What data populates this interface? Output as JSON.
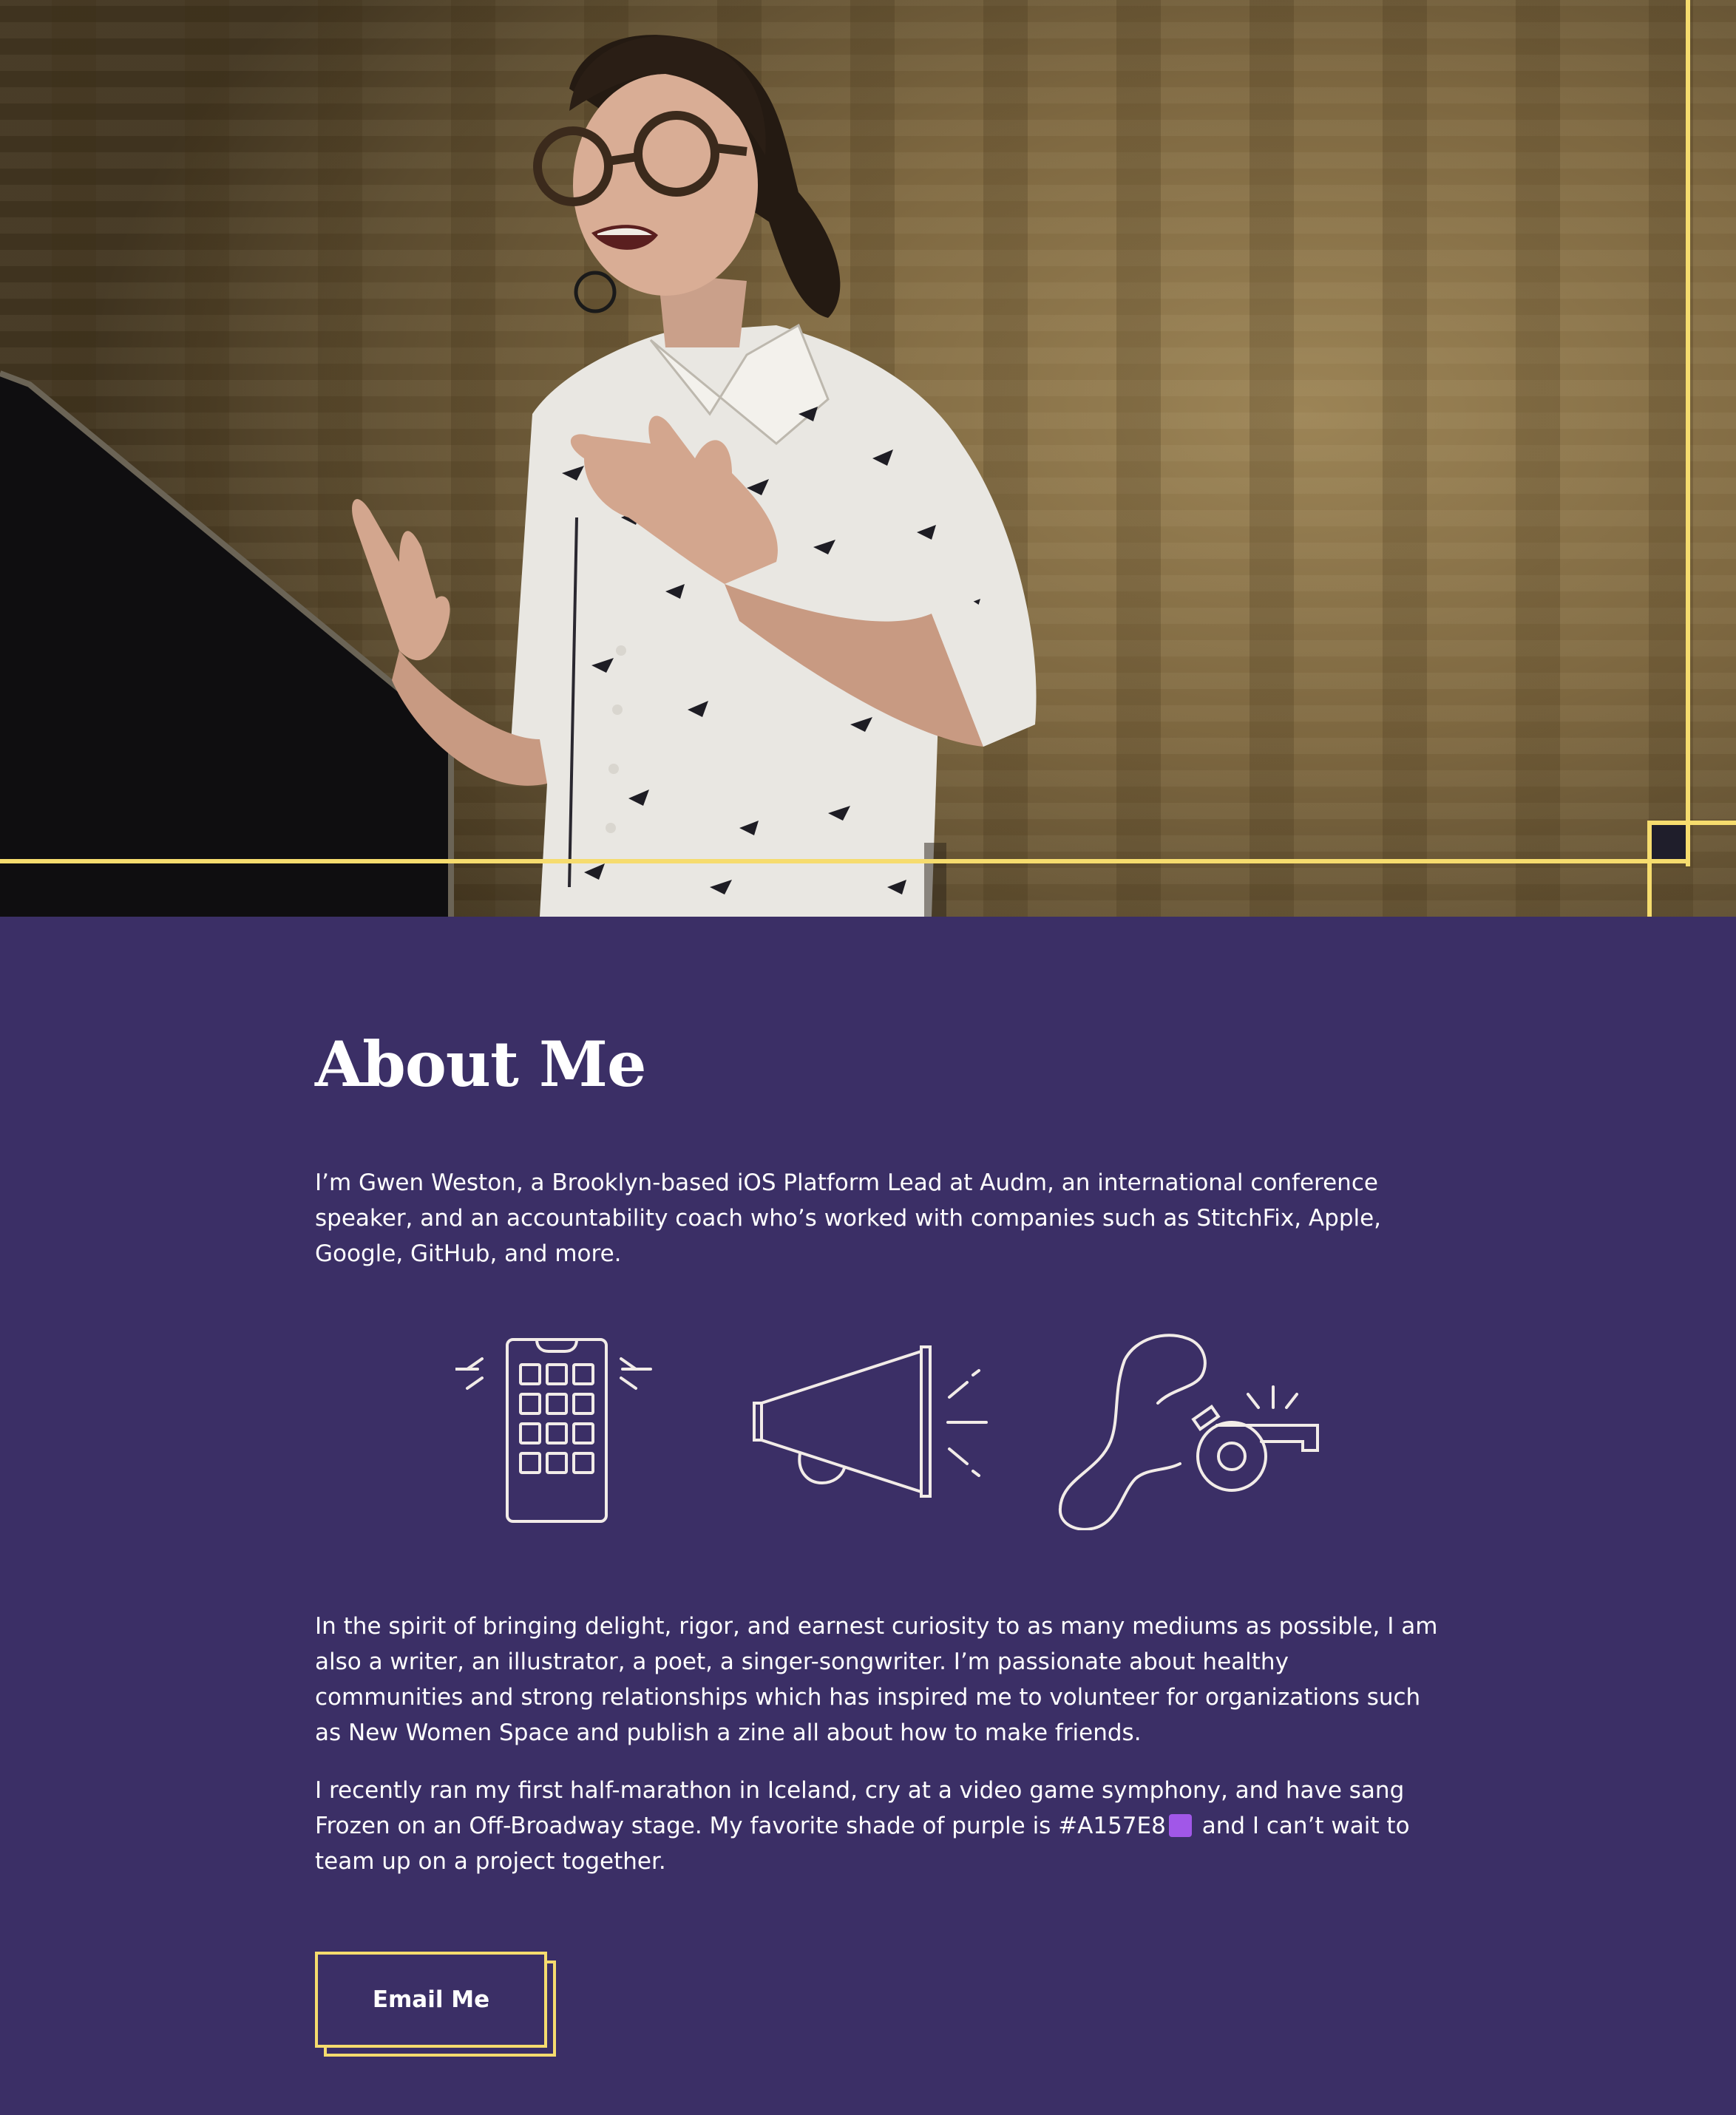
{
  "hero": {
    "image": "speaker-photo",
    "frame_color": "#f6dc6e"
  },
  "about": {
    "title": "About Me",
    "intro": "I’m Gwen Weston, a Brooklyn-based iOS Platform Lead at Audm, an international conference speaker, and an accountability coach who’s worked with companies such as StitchFix, Apple, Google, GitHub, and more.",
    "icons": [
      "phone-icon",
      "megaphone-icon",
      "whistle-icon"
    ],
    "paragraph_2": "In the spirit of bringing delight, rigor, and earnest curiosity to as many mediums as possible, I am also a writer, an illustrator, a poet, a singer-songwriter. I’m passionate about healthy communities and strong relationships which has inspired me to volunteer for organizations such as New Women Space and publish a zine all about how to make friends.",
    "paragraph_3_before": "I recently ran my first half-marathon in Iceland, cry at a video game symphony, and have sang Frozen on an Off-Broadway stage. My favorite shade of purple is #A157E8",
    "paragraph_3_after": " and I can’t wait to team up on a project together.",
    "swatch_color": "#A157E8",
    "email_button": "Email Me"
  },
  "colors": {
    "background": "#3b2f66",
    "accent": "#f6dc6e",
    "text": "#ffffff"
  }
}
